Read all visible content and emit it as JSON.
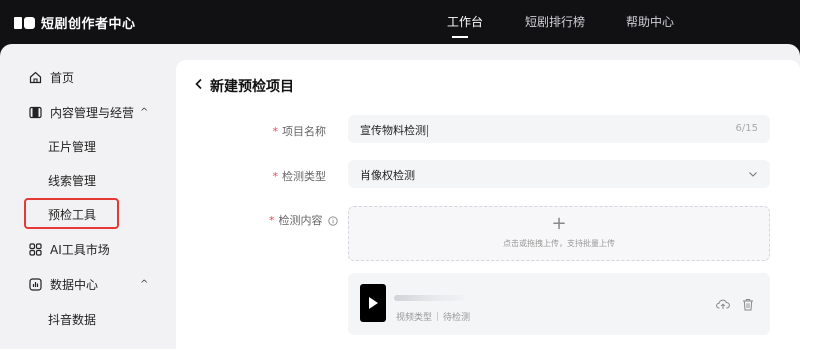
{
  "header": {
    "logo_text": "短剧创作者中心",
    "nav": [
      {
        "label": "工作台",
        "active": true
      },
      {
        "label": "短剧排行榜",
        "active": false
      },
      {
        "label": "帮助中心",
        "active": false
      }
    ]
  },
  "sidebar": {
    "items": [
      {
        "label": "首页",
        "icon": "home-icon"
      },
      {
        "label": "内容管理与经营",
        "icon": "film-icon",
        "chevron": "^"
      },
      {
        "label": "正片管理"
      },
      {
        "label": "线索管理"
      },
      {
        "label": "预检工具",
        "selected": true
      },
      {
        "label": "AI工具市场",
        "icon": "grid-icon"
      },
      {
        "label": "数据中心",
        "icon": "chart-icon",
        "chevron": "^"
      },
      {
        "label": "抖音数据"
      }
    ]
  },
  "page": {
    "back_icon": "chevron-left-icon",
    "title": "新建预检项目"
  },
  "form": {
    "name_label": "项目名称",
    "name_value": "宣传物料检测",
    "name_counter": "6/15",
    "type_label": "检测类型",
    "type_value": "肖像权检测",
    "content_label": "检测内容",
    "required_mark": "*",
    "upload_plus": "+",
    "upload_hint": "点击或拖拽上传，支持批量上传"
  },
  "file_card": {
    "type_label": "视频类型",
    "status": "待检测"
  },
  "colors": {
    "header_bg": "#111114",
    "required": "#f0444a",
    "highlight": "#e53935"
  }
}
